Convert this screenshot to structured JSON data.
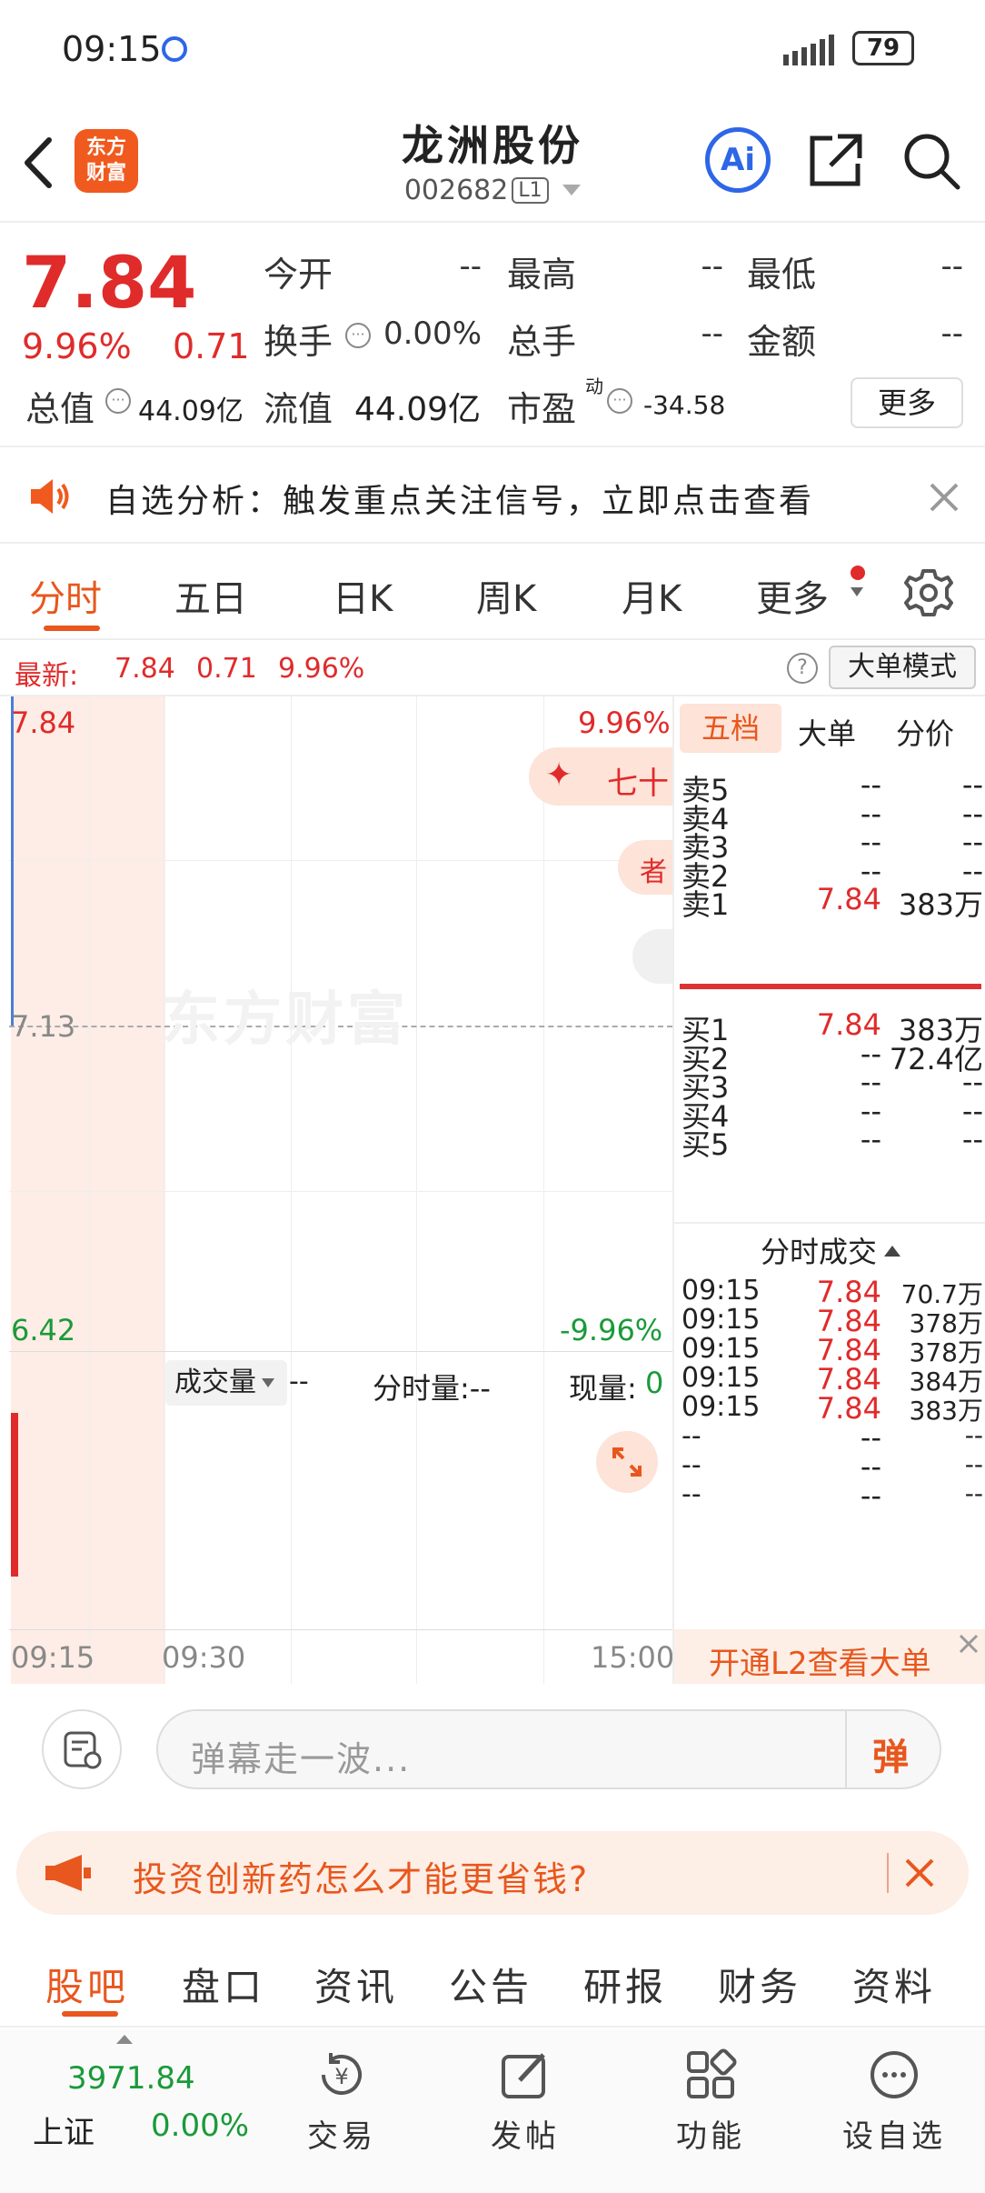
{
  "status_bar": {
    "time": "09:15",
    "battery": "79"
  },
  "header": {
    "logo_text": "东方财富",
    "stock_name": "龙洲股份",
    "stock_code": "002682",
    "level": "L1",
    "ai_label": "Ai"
  },
  "quote": {
    "price": "7.84",
    "change_pct": "9.96%",
    "change": "0.71",
    "open_label": "今开",
    "open": "--",
    "high_label": "最高",
    "high": "--",
    "low_label": "最低",
    "low": "--",
    "turnover_label": "换手",
    "turnover": "0.00%",
    "volume_label": "总手",
    "volume": "--",
    "amount_label": "金额",
    "amount": "--",
    "mcap_label": "总值",
    "mcap": "44.09亿",
    "float_label": "流值",
    "float": "44.09亿",
    "pe_label": "市盈",
    "pe_sup": "动",
    "pe": "-34.58",
    "more": "更多"
  },
  "notice": {
    "text": "自选分析：触发重点关注信号，立即点击查看"
  },
  "tabs": [
    "分时",
    "五日",
    "日K",
    "周K",
    "月K",
    "更多"
  ],
  "latest": {
    "label": "最新:",
    "price": "7.84",
    "change": "0.71",
    "pct": "9.96%",
    "mode_button": "大单模式"
  },
  "chart": {
    "y_high": "7.84",
    "y_mid": "7.13",
    "y_low": "6.42",
    "pct_high": "9.96%",
    "pct_low": "-9.96%",
    "watermark": "东方财富",
    "bubble_1": "七十",
    "bubble_2": "者",
    "volume_label": "成交量",
    "volume_value": "--",
    "minute_volume": "分时量:--",
    "current_volume_label": "现量:",
    "current_volume_value": "0",
    "time_start": "09:15",
    "time_mid": "09:30",
    "time_end": "15:00"
  },
  "book": {
    "tabs": [
      "五档",
      "大单",
      "分价"
    ],
    "asks": [
      {
        "label": "卖5",
        "price": "--",
        "vol": "--"
      },
      {
        "label": "卖4",
        "price": "--",
        "vol": "--"
      },
      {
        "label": "卖3",
        "price": "--",
        "vol": "--"
      },
      {
        "label": "卖2",
        "price": "--",
        "vol": "--"
      },
      {
        "label": "卖1",
        "price": "7.84",
        "vol": "383万"
      }
    ],
    "bids": [
      {
        "label": "买1",
        "price": "7.84",
        "vol": "383万"
      },
      {
        "label": "买2",
        "price": "--",
        "vol": "72.4亿"
      },
      {
        "label": "买3",
        "price": "--",
        "vol": "--"
      },
      {
        "label": "买4",
        "price": "--",
        "vol": "--"
      },
      {
        "label": "买5",
        "price": "--",
        "vol": "--"
      }
    ],
    "ticks_title": "分时成交",
    "ticks": [
      {
        "time": "09:15",
        "price": "7.84",
        "vol": "70.7万"
      },
      {
        "time": "09:15",
        "price": "7.84",
        "vol": "378万"
      },
      {
        "time": "09:15",
        "price": "7.84",
        "vol": "378万"
      },
      {
        "time": "09:15",
        "price": "7.84",
        "vol": "384万"
      },
      {
        "time": "09:15",
        "price": "7.84",
        "vol": "383万"
      },
      {
        "time": "--",
        "price": "--",
        "vol": "--"
      },
      {
        "time": "--",
        "price": "--",
        "vol": "--"
      },
      {
        "time": "--",
        "price": "--",
        "vol": "--"
      }
    ],
    "l2_banner": "开通L2查看大单"
  },
  "comment": {
    "placeholder": "弹幕走一波...",
    "send": "弹"
  },
  "promo": {
    "text": "投资创新药怎么才能更省钱?"
  },
  "bottom_tabs": [
    "股吧",
    "盘口",
    "资讯",
    "公告",
    "研报",
    "财务",
    "资料"
  ],
  "bottom_nav": {
    "index_value": "3971.84",
    "index_name": "上证",
    "index_pct": "0.00%",
    "items": [
      "交易",
      "发帖",
      "功能",
      "设自选"
    ]
  },
  "colors": {
    "up": "#e02b2b",
    "down": "#1a9a3a",
    "accent": "#e8571d",
    "ai_blue": "#2e66e8"
  }
}
